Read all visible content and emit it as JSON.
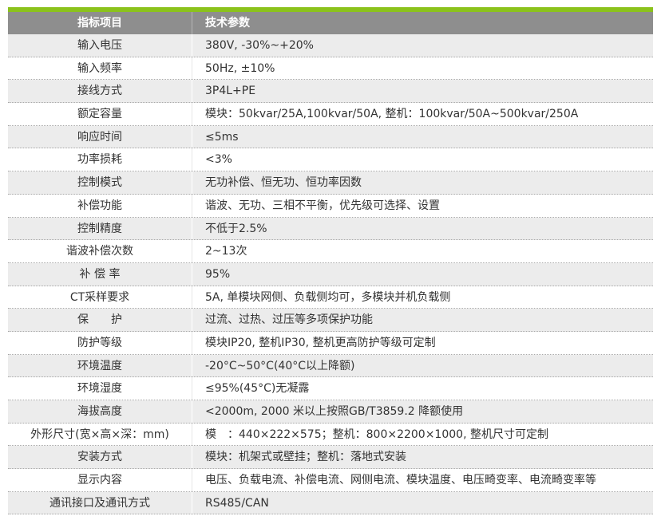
{
  "header": {
    "label": "指标项目",
    "value": "技术参数"
  },
  "rows": [
    {
      "label": "输入电压",
      "value": "380V, -30%~+20%"
    },
    {
      "label": "输入频率",
      "value": "50Hz, ±10%"
    },
    {
      "label": "接线方式",
      "value": "3P4L+PE"
    },
    {
      "label": "额定容量",
      "value": "模块：50kvar/25A,100kvar/50A, 整机：100kvar/50A~500kvar/250A"
    },
    {
      "label": "响应时间",
      "value": "≤5ms"
    },
    {
      "label": "功率损耗",
      "value": "<3%"
    },
    {
      "label": "控制模式",
      "value": "无功补偿、恒无功、恒功率因数"
    },
    {
      "label": "补偿功能",
      "value": "谐波、无功、三相不平衡，优先级可选择、设置"
    },
    {
      "label": "控制精度",
      "value": "不低于2.5%"
    },
    {
      "label": "谐波补偿次数",
      "value": "2~13次"
    },
    {
      "label": "补 偿 率",
      "value": "95%"
    },
    {
      "label": "CT采样要求",
      "value": "5A, 单模块网侧、负载侧均可，多模块并机负载侧"
    },
    {
      "label": "保　　护",
      "value": "过流、过热、过压等多项保护功能"
    },
    {
      "label": "防护等级",
      "value": "模块IP20, 整机IP30, 整机更高防护等级可定制"
    },
    {
      "label": "环境温度",
      "value": "-20°C~50°C(40°C以上降额)"
    },
    {
      "label": "环境湿度",
      "value": "≤95%(45°C)无凝露"
    },
    {
      "label": "海拔高度",
      "value": "<2000m, 2000 米以上按照GB/T3859.2 降额使用"
    },
    {
      "label": "外形尺寸(宽×高×深：mm)",
      "value": "模　：440×222×575；整机：800×2200×1000, 整机尺寸可定制"
    },
    {
      "label": "安装方式",
      "value": "模块：机架式或壁挂；整机：落地式安装"
    },
    {
      "label": "显示内容",
      "value": "电压、负载电流、补偿电流、网侧电流、模块温度、电压畸变率、电流畸变率等"
    },
    {
      "label": "通讯接口及通讯方式",
      "value": "RS485/CAN"
    }
  ],
  "colors": {
    "accent_bar": "#8bc21c",
    "header_bg": "#8e8e8e",
    "alt_row_bg": "#ececec"
  }
}
